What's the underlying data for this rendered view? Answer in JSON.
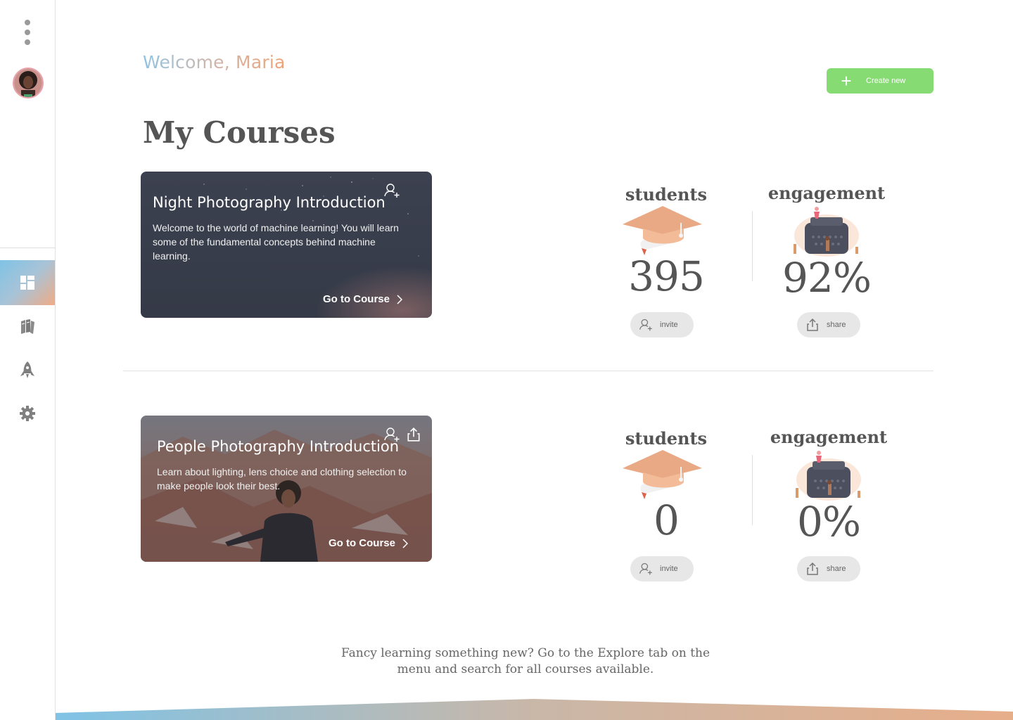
{
  "header": {
    "welcome": "Welcome, Maria",
    "create_label": "Create new",
    "title": "My Courses"
  },
  "courses": [
    {
      "title": "Night Photography Introduction",
      "description": "Welcome to the world of machine learning! You will learn some of the fundamental concepts behind machine learning.",
      "cta": "Go to Course",
      "icons": [
        "add-person-icon"
      ],
      "stats": {
        "students_label": "students",
        "students_value": "395",
        "engagement_label": "engagement",
        "engagement_value": "92%",
        "invite_label": "invite",
        "share_label": "share"
      }
    },
    {
      "title": "People Photography Introduction",
      "description": "Learn about lighting, lens choice and clothing selection to make people look their best.",
      "cta": "Go to Course",
      "icons": [
        "add-person-icon",
        "share-icon"
      ],
      "stats": {
        "students_label": "students",
        "students_value": "0",
        "engagement_label": "engagement",
        "engagement_value": "0%",
        "invite_label": "invite",
        "share_label": "share"
      }
    }
  ],
  "footer": {
    "message_line1": "Fancy learning something new? Go to the Explore tab on the",
    "message_line2": "menu and search for all courses available."
  },
  "sidebar": {
    "items": [
      "dashboard-icon",
      "books-icon",
      "rocket-icon",
      "gear-icon"
    ],
    "active": "dashboard-icon"
  },
  "colors": {
    "accent_green": "#86dc72",
    "gradient_blue": "#7fc3e6",
    "gradient_orange": "#f0ab85",
    "text_dark": "#555555"
  }
}
